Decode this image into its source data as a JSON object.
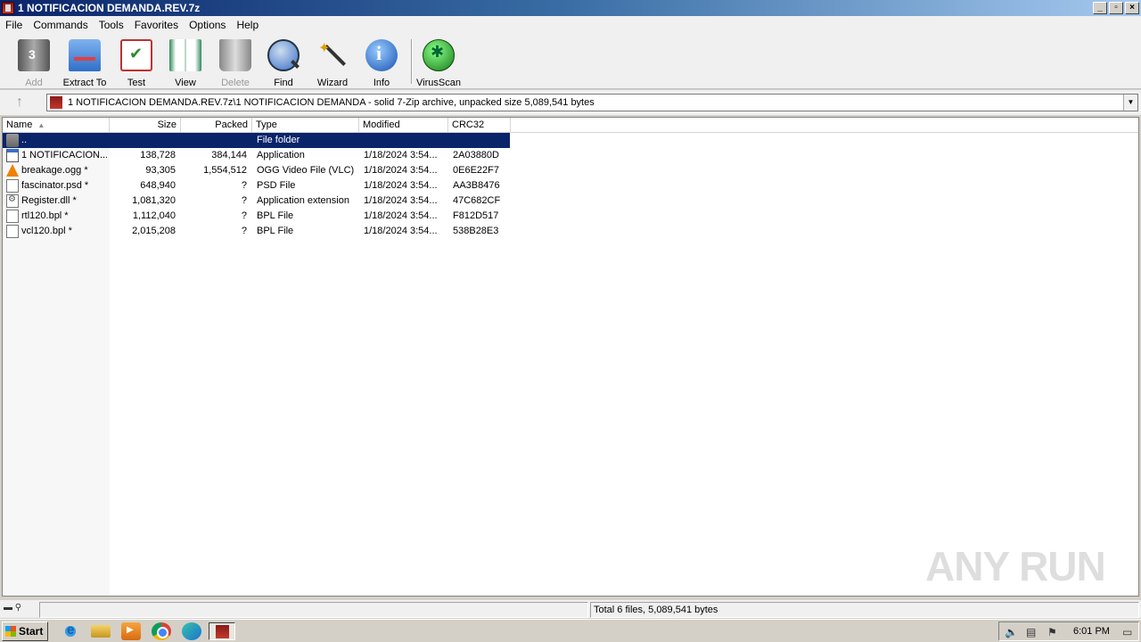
{
  "window": {
    "title": "1 NOTIFICACION DEMANDA.REV.7z",
    "controls": [
      "_",
      "▫",
      "×"
    ]
  },
  "menu": [
    "File",
    "Commands",
    "Tools",
    "Favorites",
    "Options",
    "Help"
  ],
  "toolbar": {
    "add": "Add",
    "extract_to": "Extract To",
    "test": "Test",
    "view": "View",
    "delete": "Delete",
    "find": "Find",
    "wizard": "Wizard",
    "info": "Info",
    "virusscan": "VirusScan"
  },
  "address": {
    "path": "1 NOTIFICACION DEMANDA.REV.7z\\1 NOTIFICACION DEMANDA - solid 7-Zip archive, unpacked size 5,089,541 bytes"
  },
  "columns": {
    "name": "Name",
    "size": "Size",
    "packed": "Packed",
    "type": "Type",
    "modified": "Modified",
    "crc32": "CRC32"
  },
  "files": [
    {
      "name": "..",
      "size": "",
      "packed": "",
      "type": "File folder",
      "modified": "",
      "crc": "",
      "icon": "folder-icon"
    },
    {
      "name": "1 NOTIFICACION...",
      "size": "138,728",
      "packed": "384,144",
      "type": "Application",
      "modified": "1/18/2024 3:54...",
      "crc": "2A03880D",
      "icon": "application-icon"
    },
    {
      "name": "breakage.ogg *",
      "size": "93,305",
      "packed": "1,554,512",
      "type": "OGG Video File (VLC)",
      "modified": "1/18/2024 3:54...",
      "crc": "0E6E22F7",
      "icon": "vlc-icon"
    },
    {
      "name": "fascinator.psd *",
      "size": "648,940",
      "packed": "?",
      "type": "PSD File",
      "modified": "1/18/2024 3:54...",
      "crc": "AA3B8476",
      "icon": "file-icon"
    },
    {
      "name": "Register.dll *",
      "size": "1,081,320",
      "packed": "?",
      "type": "Application extension",
      "modified": "1/18/2024 3:54...",
      "crc": "47C682CF",
      "icon": "dll-icon"
    },
    {
      "name": "rtl120.bpl *",
      "size": "1,112,040",
      "packed": "?",
      "type": "BPL File",
      "modified": "1/18/2024 3:54...",
      "crc": "F812D517",
      "icon": "file-icon"
    },
    {
      "name": "vcl120.bpl *",
      "size": "2,015,208",
      "packed": "?",
      "type": "BPL File",
      "modified": "1/18/2024 3:54...",
      "crc": "538B28E3",
      "icon": "file-icon"
    }
  ],
  "status": {
    "total": "Total 6 files, 5,089,541 bytes"
  },
  "taskbar": {
    "start": "Start",
    "clock": "6:01 PM"
  },
  "watermark": "ANY RUN"
}
